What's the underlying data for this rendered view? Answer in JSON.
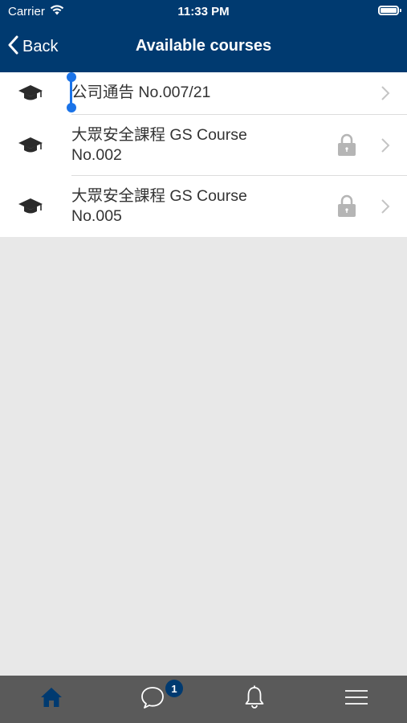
{
  "status_bar": {
    "carrier": "Carrier",
    "time": "11:33 PM"
  },
  "nav": {
    "back_label": "Back",
    "title": "Available courses"
  },
  "courses": [
    {
      "title_line1": "公司通告 No.007/21",
      "title_line2": "",
      "locked": false,
      "icon": "graduation-cap-icon"
    },
    {
      "title_line1": "大眾安全課程 GS Course",
      "title_line2": "No.002",
      "locked": true,
      "icon": "graduation-cap-icon"
    },
    {
      "title_line1": "大眾安全課程 GS Course",
      "title_line2": "No.005",
      "locked": true,
      "icon": "graduation-cap-icon"
    }
  ],
  "tab_bar": {
    "tabs": [
      {
        "name": "home",
        "icon": "home-icon",
        "active": true
      },
      {
        "name": "chat",
        "icon": "chat-bubble-icon",
        "active": false
      },
      {
        "name": "notifications",
        "icon": "bell-icon",
        "active": false
      },
      {
        "name": "menu",
        "icon": "hamburger-menu-icon",
        "active": false
      }
    ],
    "chat_badge": "1"
  },
  "colors": {
    "header_bg": "#003a70",
    "active_tab": "#003a70",
    "tab_bar_bg": "#5a5a5a",
    "content_bg": "#e8e8e8",
    "cursor": "#1a73e8"
  }
}
